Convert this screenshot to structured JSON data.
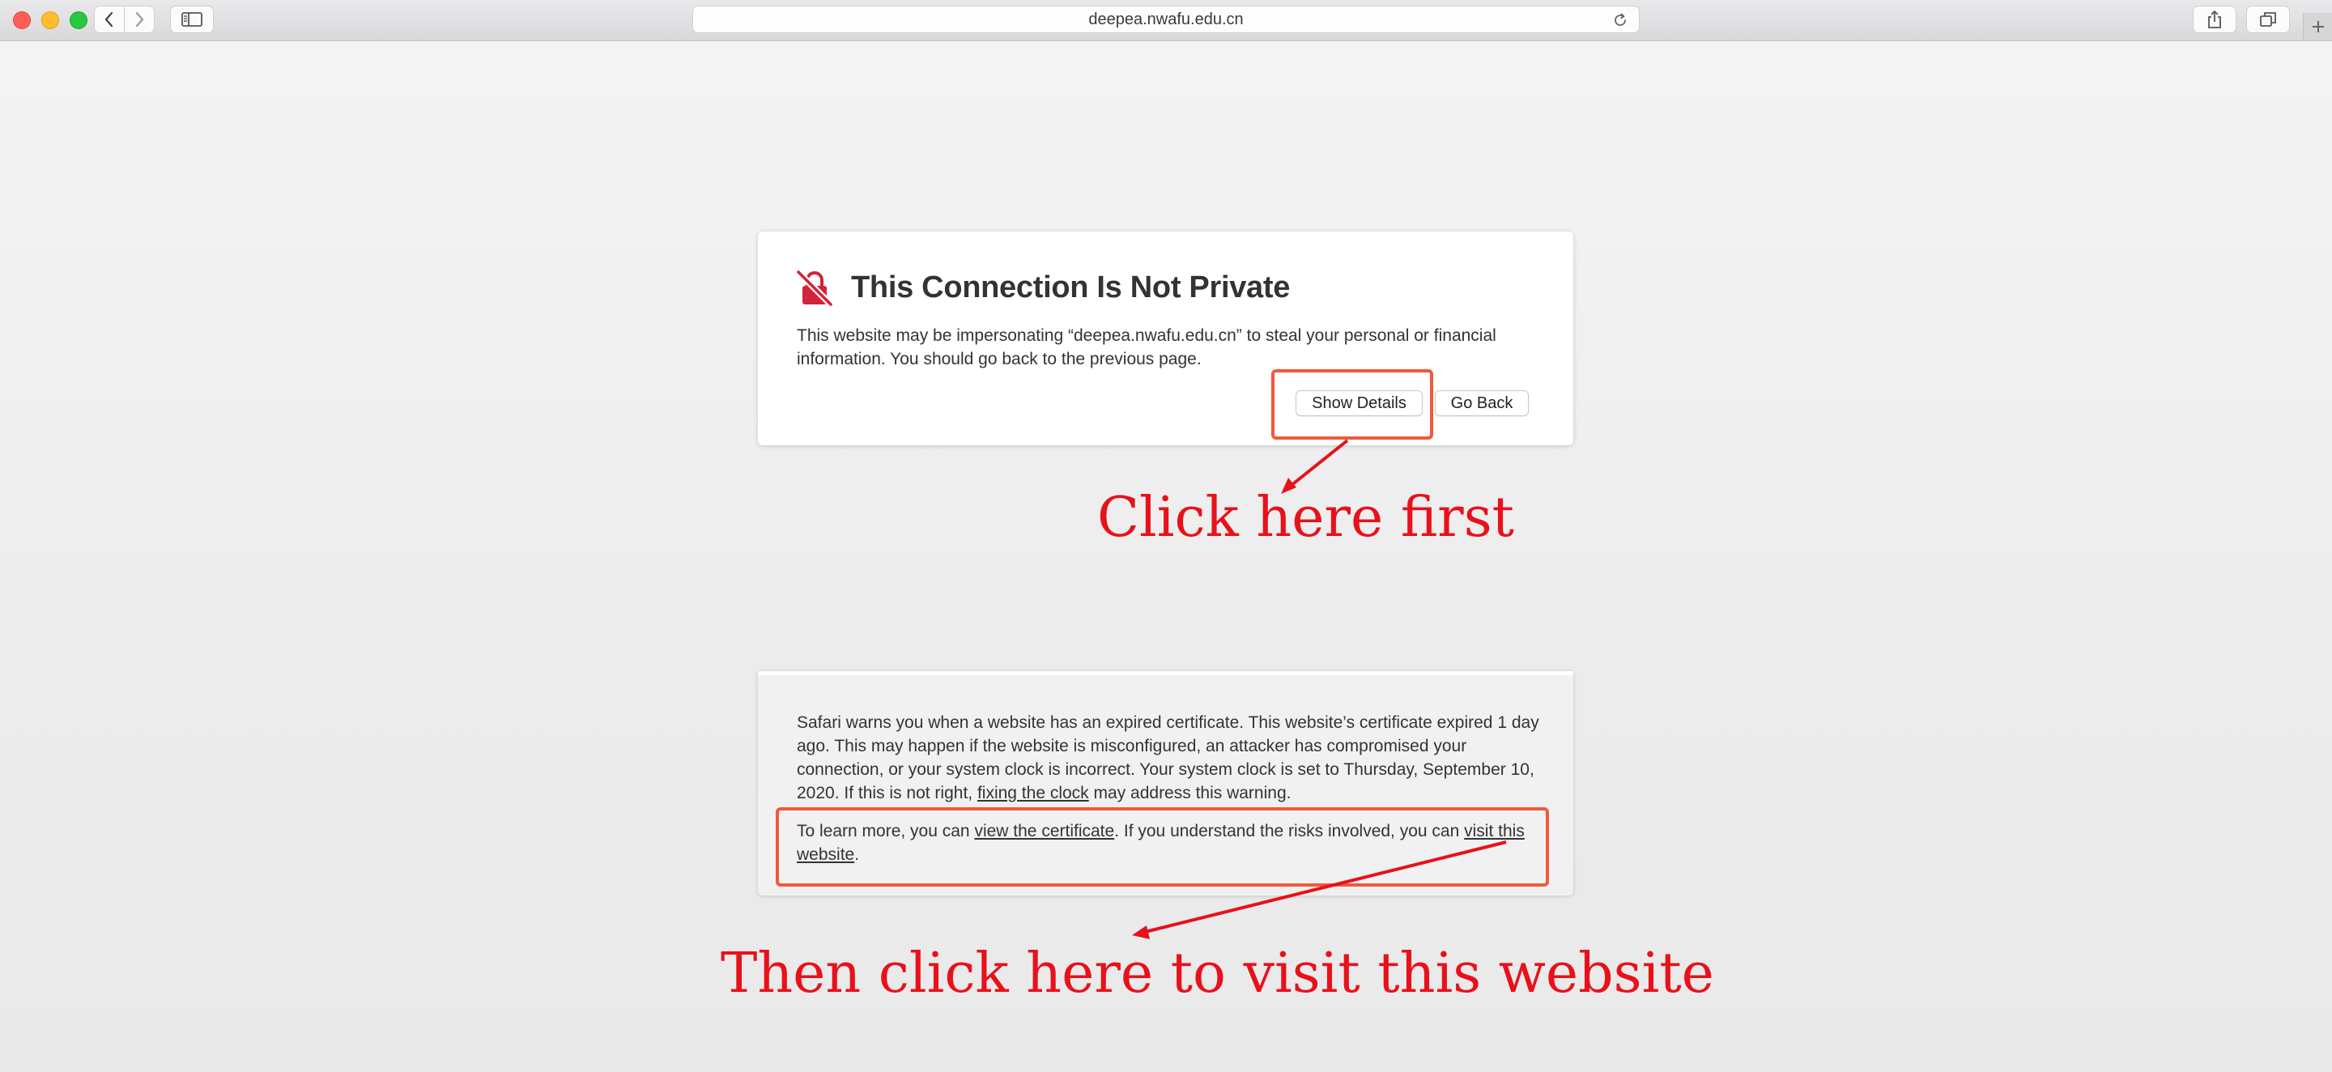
{
  "browser": {
    "url": "deepea.nwafu.edu.cn",
    "icons": {
      "back": "chevron-left-icon",
      "forward": "chevron-right-icon",
      "sidebar": "sidebar-icon",
      "reload": "reload-icon",
      "share": "share-icon",
      "tabs": "tabs-overview-icon",
      "new_tab": "plus-icon"
    }
  },
  "warning": {
    "icon": "broken-lock-icon",
    "title": "This Connection Is Not Private",
    "message": "This website may be impersonating “deepea.nwafu.edu.cn” to steal your personal or financial information. You should go back to the previous page.",
    "show_details_label": "Show Details",
    "go_back_label": "Go Back"
  },
  "details": {
    "p1_text": "Safari warns you when a website has an expired certificate. This website’s certificate expired 1 day ago. This may happen if the website is misconfigured, an attacker has compromised your connection, or your system clock is incorrect. Your system clock is set to Thursday, September 10, 2020. If this is not right, ",
    "p1_link": "fixing the clock",
    "p1_end": " may address this warning.",
    "p2_start": "To learn more, you can ",
    "p2_link1": "view the certificate",
    "p2_mid": ". If you understand the risks involved, you can ",
    "p2_link2": "visit this website",
    "p2_end": "."
  },
  "annotations": {
    "note1": "Click here first",
    "note2": "Then click here to visit this website",
    "color": "#e8111a",
    "highlight_color": "#f05a3a"
  },
  "colors": {
    "warning_icon": "#d0243a",
    "page_background": "#ededee"
  }
}
